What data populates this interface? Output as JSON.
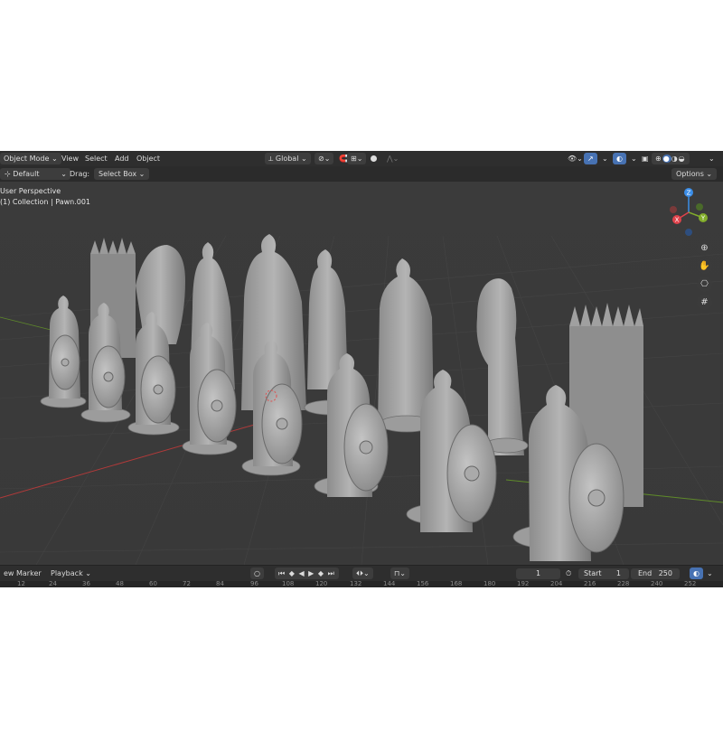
{
  "header": {
    "mode": "Object Mode",
    "menu": [
      "View",
      "Select",
      "Add",
      "Object"
    ],
    "transform_orientation": "Global"
  },
  "toolbar": {
    "orientation": "Default",
    "drag_label": "Drag:",
    "drag_value": "Select Box",
    "options": "Options"
  },
  "viewport": {
    "perspective": "User Perspective",
    "collection": "(1) Collection | Pawn.001",
    "gizmo_axes": [
      "Z",
      "Y",
      "X"
    ],
    "colors": {
      "x": "#e0424b",
      "y": "#82ad2b",
      "z": "#3b8ee8",
      "background": "#3a3a3a"
    }
  },
  "timeline": {
    "menu": [
      "ew",
      "Marker",
      "Playback"
    ],
    "current_frame": "1",
    "start_label": "Start",
    "start_value": "1",
    "end_label": "End",
    "end_value": "250",
    "ruler_ticks": [
      "12",
      "24",
      "36",
      "48",
      "60",
      "72",
      "84",
      "96",
      "108",
      "120",
      "132",
      "144",
      "156",
      "168",
      "180",
      "192",
      "204",
      "216",
      "228",
      "240",
      "252"
    ]
  },
  "icons": [
    "object-mode-icon",
    "transform-icon",
    "pivot-icon",
    "snap-icon",
    "proportional-icon",
    "visibility-icon",
    "gizmo-icon",
    "overlay-icon",
    "xray-icon",
    "shading-icons",
    "zoom-icon",
    "hand-icon",
    "camera-icon",
    "grid-icon",
    "playback-controls",
    "keying-icon",
    "stopwatch-icon",
    "sync-icon"
  ]
}
